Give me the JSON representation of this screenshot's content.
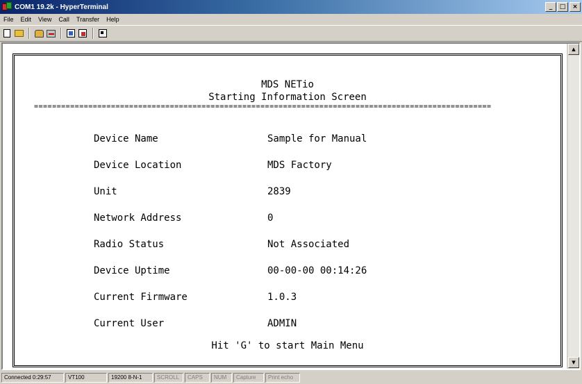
{
  "window": {
    "title": "COM1 19.2k - HyperTerminal",
    "controls": {
      "minimize": "_",
      "maximize": "□",
      "close": "×"
    }
  },
  "menu": [
    "File",
    "Edit",
    "View",
    "Call",
    "Transfer",
    "Help"
  ],
  "toolbar": {
    "buttons": [
      "new-connection-icon",
      "open-icon",
      "call-icon",
      "disconnect-icon",
      "send-file-icon",
      "receive-file-icon",
      "properties-icon"
    ]
  },
  "terminal": {
    "title": "MDS NETio",
    "subtitle": "Starting Information Screen",
    "rule": "=====================================================================================================",
    "rows": [
      {
        "label": "Device Name",
        "value": "Sample for Manual"
      },
      {
        "label": "Device Location",
        "value": "MDS Factory"
      },
      {
        "label": "Unit",
        "value": "2839"
      },
      {
        "label": "Network Address",
        "value": "0"
      },
      {
        "label": "Radio Status",
        "value": "Not Associated"
      },
      {
        "label": "Device Uptime",
        "value": "00-00-00 00:14:26"
      },
      {
        "label": "Current Firmware",
        "value": "1.0.3"
      },
      {
        "label": "Current User",
        "value": "ADMIN"
      }
    ],
    "footer": "Hit 'G' to start Main Menu"
  },
  "statusbar": {
    "connected": "Connected 0:29:57",
    "emulation": "VT100",
    "settings": "19200 8-N-1",
    "scroll": "SCROLL",
    "caps": "CAPS",
    "num": "NUM",
    "capture": "Capture",
    "print_echo": "Print echo"
  },
  "colors": {
    "titlebar_start": "#0a246a",
    "titlebar_end": "#a6caf0",
    "chrome": "#d4d0c8",
    "terminal_bg": "#ffffff",
    "terminal_text": "#000000"
  }
}
